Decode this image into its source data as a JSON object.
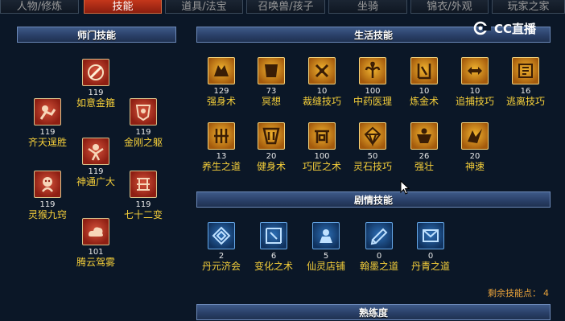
{
  "tabs": [
    {
      "label": "人物/修炼"
    },
    {
      "label": "技能"
    },
    {
      "label": "道具/法宝"
    },
    {
      "label": "召唤兽/孩子"
    },
    {
      "label": "坐骑"
    },
    {
      "label": "锦衣/外观"
    },
    {
      "label": "玩家之家"
    }
  ],
  "logo": {
    "text": "CC直播"
  },
  "sections": {
    "master": "师门技能",
    "life": "生活技能",
    "story": "剧情技能",
    "proficiency": "熟练度"
  },
  "master_skills": [
    {
      "level": "119",
      "name": "如意金箍",
      "icon": "staff-icon"
    },
    {
      "level": "119",
      "name": "齐天逞胜",
      "icon": "monkey-fight-icon"
    },
    {
      "level": "119",
      "name": "金刚之躯",
      "icon": "armor-icon"
    },
    {
      "level": "119",
      "name": "神通广大",
      "icon": "spirit-icon"
    },
    {
      "level": "119",
      "name": "灵猴九窍",
      "icon": "monkey-icon"
    },
    {
      "level": "119",
      "name": "七十二变",
      "icon": "transform-icon"
    },
    {
      "level": "101",
      "name": "腾云驾雾",
      "icon": "cloud-icon"
    }
  ],
  "life_skills": [
    {
      "level": "129",
      "name": "强身术",
      "icon": "muscle-icon"
    },
    {
      "level": "73",
      "name": "冥想",
      "icon": "meditate-icon"
    },
    {
      "level": "10",
      "name": "裁缝技巧",
      "icon": "scissors-icon"
    },
    {
      "level": "100",
      "name": "中药医理",
      "icon": "herb-icon"
    },
    {
      "level": "10",
      "name": "炼金术",
      "icon": "alchemy-icon"
    },
    {
      "level": "10",
      "name": "追捕技巧",
      "icon": "chase-icon"
    },
    {
      "level": "16",
      "name": "逃离技巧",
      "icon": "escape-icon"
    },
    {
      "level": "13",
      "name": "养生之道",
      "icon": "health-icon"
    },
    {
      "level": "20",
      "name": "健身术",
      "icon": "fitness-icon"
    },
    {
      "level": "100",
      "name": "巧匠之术",
      "icon": "craft-icon"
    },
    {
      "level": "50",
      "name": "灵石技巧",
      "icon": "gem-icon"
    },
    {
      "level": "26",
      "name": "强壮",
      "icon": "strong-icon"
    },
    {
      "level": "20",
      "name": "神速",
      "icon": "speed-icon"
    }
  ],
  "story_skills": [
    {
      "level": "2",
      "name": "丹元济会",
      "icon": "pill-icon"
    },
    {
      "level": "6",
      "name": "变化之术",
      "icon": "change-icon"
    },
    {
      "level": "5",
      "name": "仙灵店铺",
      "icon": "shop-icon"
    },
    {
      "level": "0",
      "name": "翰墨之道",
      "icon": "ink-icon"
    },
    {
      "level": "0",
      "name": "丹青之道",
      "icon": "painting-icon"
    }
  ],
  "remaining_points": {
    "label": "剩余技能点：",
    "value": "4"
  }
}
